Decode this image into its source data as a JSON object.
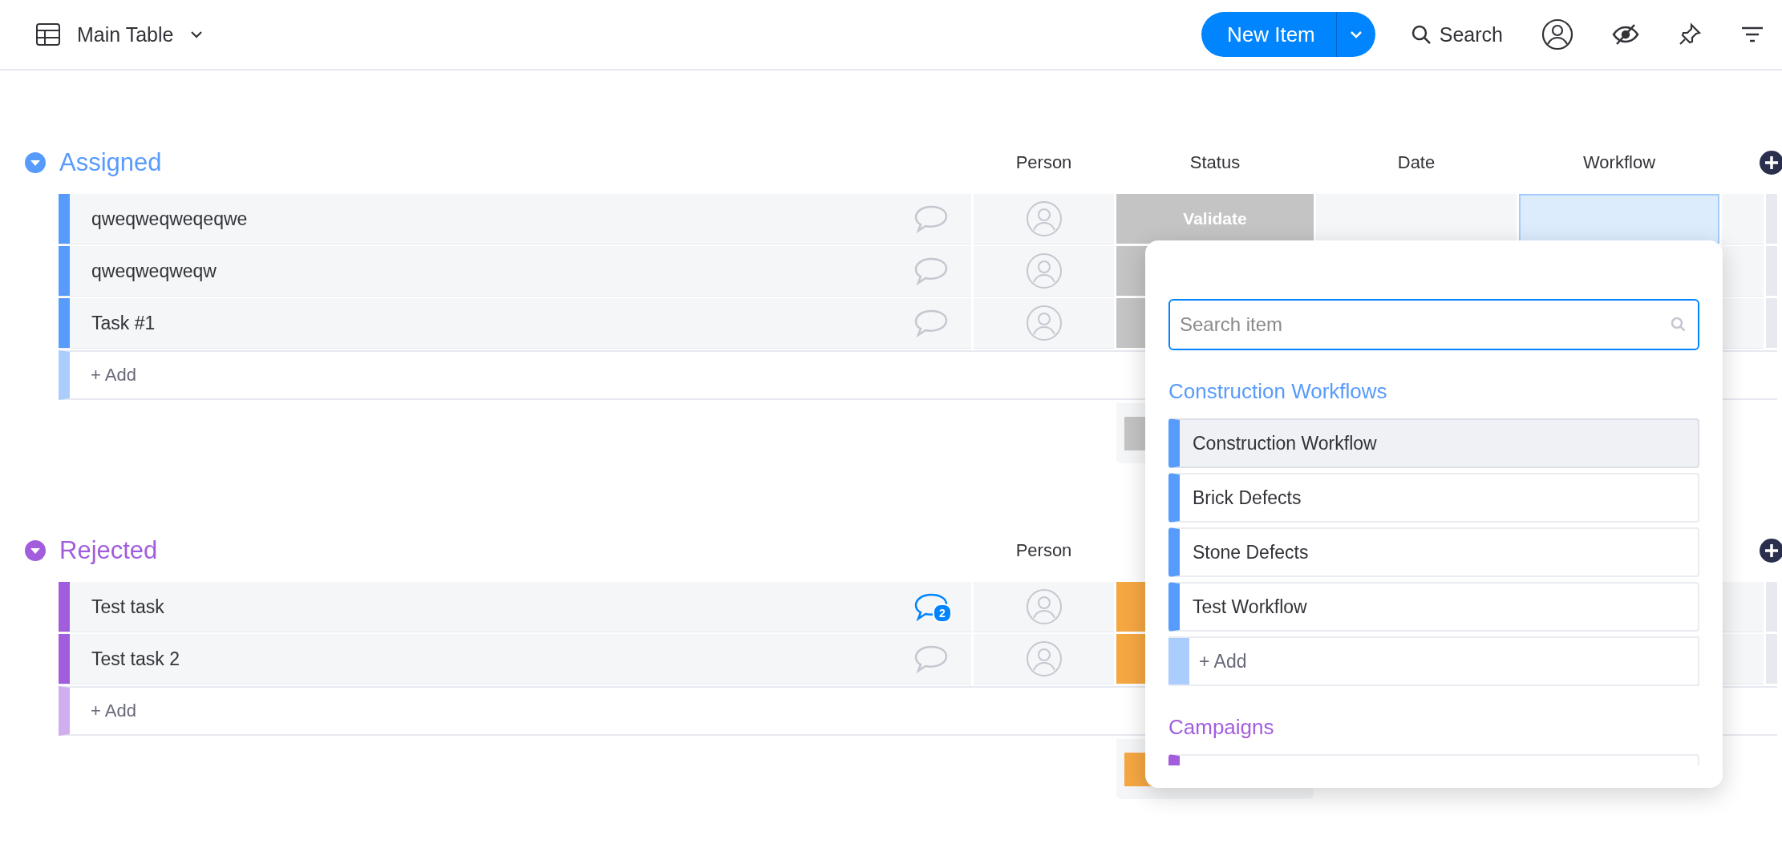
{
  "header": {
    "board_view": "Main Table",
    "new_item_button": "New Item",
    "search_label": "Search"
  },
  "groups": [
    {
      "title": "Assigned",
      "color": "#579bfc",
      "columns": [
        "Person",
        "Status",
        "Date",
        "Workflow"
      ],
      "add_label": "+ Add",
      "rows": [
        {
          "name": "qweqweqweqeqwe",
          "status": {
            "label": "Validate",
            "color": "#c4c4c4"
          },
          "workflow_selected": true
        },
        {
          "name": "qweqweqweqw",
          "status": {
            "color": "#c4c4c4"
          }
        },
        {
          "name": "Task #1",
          "status": {
            "color": "#c4c4c4"
          }
        }
      ]
    },
    {
      "title": "Rejected",
      "color": "#a25ddc",
      "columns": [
        "Person"
      ],
      "add_label": "+ Add",
      "rows": [
        {
          "name": "Test task",
          "comment_count": "2",
          "status": {
            "color": "#f5a742"
          }
        },
        {
          "name": "Test task 2",
          "status": {
            "color": "#f5a742"
          }
        }
      ]
    }
  ],
  "dropdown": {
    "search": {
      "placeholder": "Search item"
    },
    "sections": [
      {
        "title": "Construction Workflows",
        "color": "#579bfc",
        "add_label": "+ Add",
        "items": [
          {
            "label": "Construction Workflow",
            "selected": true
          },
          {
            "label": "Brick Defects",
            "selected": false
          },
          {
            "label": "Stone Defects",
            "selected": false
          },
          {
            "label": "Test Workflow",
            "selected": false
          }
        ]
      },
      {
        "title": "Campaigns",
        "color": "#a25ddc",
        "partial_item": true
      }
    ]
  }
}
